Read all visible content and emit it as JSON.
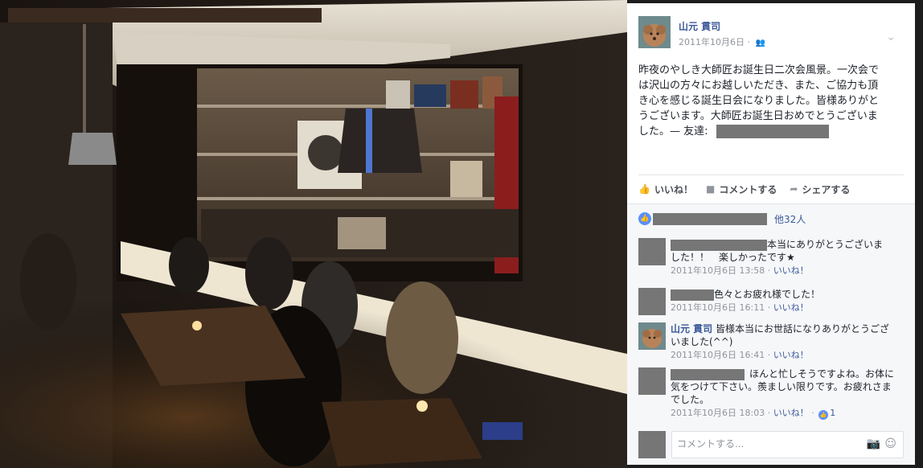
{
  "post": {
    "author": "山元 貫司",
    "date": "2011年10月6日",
    "separator": "·",
    "audience_icon": "friends-icon",
    "text_line1": "昨夜のやしき大師匠お誕生日二次会風景。一次会で",
    "text_line2": "は沢山の方々にお越しいただき、また、ご協力も頂",
    "text_line3": "き心を感じる誕生日会になりました。皆様ありがと",
    "text_line4": "うございます。大師匠お誕生日おめでとうございま",
    "text_line5": "した。— 友達:"
  },
  "actions": {
    "like": "いいね！",
    "comment": "コメントする",
    "share": "シェアする"
  },
  "likes": {
    "others": "他32人"
  },
  "comments": [
    {
      "text_line1": "本当にありがとうございま",
      "text_line2": "した！！　楽しかったです★",
      "time": "2011年10月6日 13:58",
      "like": "いいね！",
      "sep": "·"
    },
    {
      "text_line1": "色々とお疲れ様でした！",
      "time": "2011年10月6日 16:11",
      "like": "いいね！",
      "sep": "·"
    },
    {
      "author": "山元 貫司",
      "text_line1": "皆様本当にお世話になりありがとうござ",
      "text_line2": "いました(^^)",
      "time": "2011年10月6日 16:41",
      "like": "いいね！",
      "sep": "·"
    },
    {
      "text_line1": "ほんと忙しそうですよね。お体に",
      "text_line2": "気をつけて下さい。羨ましい限りです。お疲れさま",
      "text_line3": "でした。",
      "time": "2011年10月6日 18:03",
      "like": "いいね！",
      "sep": "·",
      "likes_count": "1"
    }
  ],
  "composer": {
    "placeholder": "コメントする..."
  },
  "colors": {
    "link": "#3b5998",
    "meta": "#90949c",
    "like_blue": "#5890ff",
    "redaction": "#767676"
  }
}
